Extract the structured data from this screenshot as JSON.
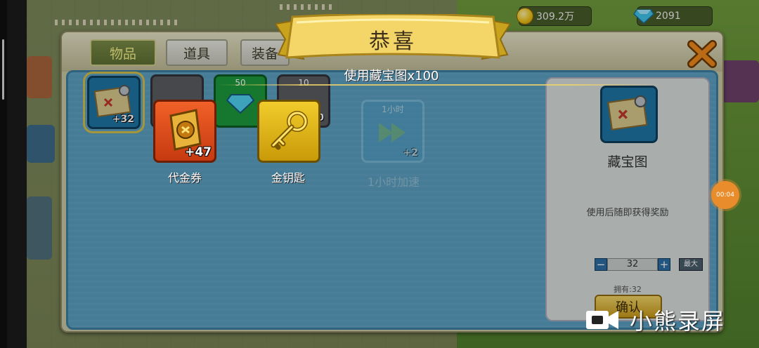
{
  "hud": {
    "gold": "309.2万",
    "gems": "2091"
  },
  "tabs": [
    {
      "label": "物品"
    },
    {
      "label": "道具"
    },
    {
      "label": "装备"
    }
  ],
  "inventory": {
    "selected_count": "+32",
    "slot2_top": "50",
    "slot3_top": "10",
    "slot3_count": "0",
    "ghost_top": "1小时",
    "ghost_count": "+2",
    "ghost_label": "1小时加速"
  },
  "detail": {
    "name": "藏宝图",
    "description": "使用后随即获得奖励",
    "quantity": "32",
    "max_label": "最大",
    "owned": "拥有:32",
    "confirm_label": "确认",
    "minus": "−",
    "plus": "+"
  },
  "congrats": {
    "title": "恭喜",
    "subtitle": "使用藏宝图x100"
  },
  "rewards": [
    {
      "label": "代金券",
      "count": "+47"
    },
    {
      "label": "金钥匙",
      "count": ""
    }
  ],
  "recording": {
    "timer": "00:04",
    "watermark": "小熊录屏"
  },
  "colors": {
    "banner_gold": "#f3d667",
    "panel_blue": "#5b9fc2",
    "close_orange": "#f08a1c"
  }
}
